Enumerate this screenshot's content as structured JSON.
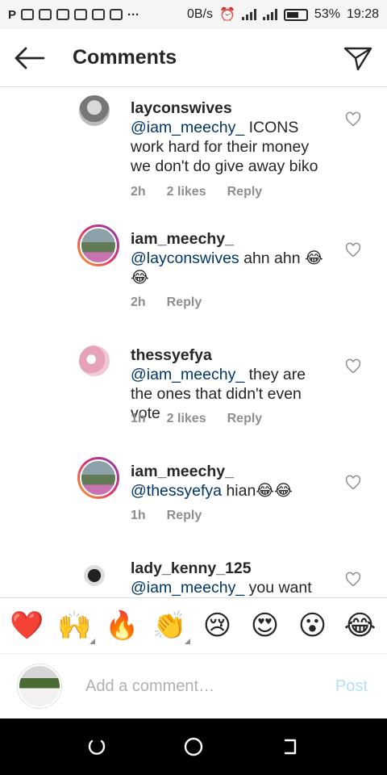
{
  "status_bar": {
    "net_speed": "0B/s",
    "battery": "53%",
    "time": "19:28"
  },
  "header": {
    "title": "Comments"
  },
  "comments": [
    {
      "username": "layconswives",
      "mention": "@iam_meechy_",
      "text": "ICONS work hard for their money we don't do give away biko",
      "time": "2h",
      "likes": "2 likes",
      "reply": "Reply"
    },
    {
      "username": "iam_meechy_",
      "mention": "@layconswives",
      "text": "ahn ahn 😂😂",
      "time": "2h",
      "likes": "",
      "reply": "Reply"
    },
    {
      "username": "thessyefya",
      "mention": "@iam_meechy_",
      "text": " they are the ones that didn't even vote",
      "time": "1h",
      "likes": "2 likes",
      "reply": "Reply"
    },
    {
      "username": "iam_meechy_",
      "mention": "@thessyefya",
      "text": "hian😂😂",
      "time": "1h",
      "likes": "",
      "reply": "Reply"
    },
    {
      "username": "lady_kenny_125",
      "mention": "@iam_meechy_",
      "text": "you want",
      "time": "",
      "likes": "",
      "reply": ""
    }
  ],
  "emoji_bar": [
    "❤️",
    "🙌",
    "🔥",
    "👏",
    "😢",
    "😍",
    "😮",
    "😂"
  ],
  "add_comment": {
    "placeholder": "Add a comment…",
    "post_label": "Post"
  }
}
